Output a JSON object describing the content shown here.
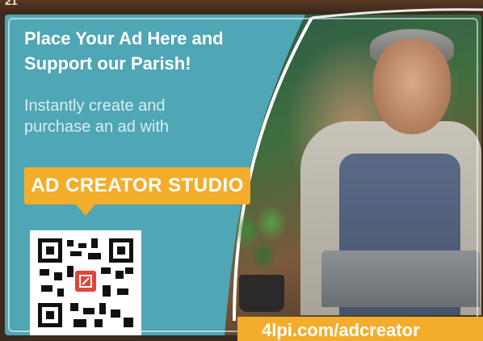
{
  "top_strip": {
    "text": "21"
  },
  "ad": {
    "headline_line1": "Place Your Ad Here and",
    "headline_line2": "Support our Parish!",
    "subtext_line1": "Instantly create and",
    "subtext_line2": "purchase an ad with",
    "cta_label": "AD CREATOR STUDIO",
    "url": "4lpi.com/adcreator"
  },
  "colors": {
    "panel": "#4fa6b5",
    "accent": "#f4ad2b",
    "frame": "#3b2a1f"
  },
  "icons": {
    "qr": "qr-code-icon"
  }
}
